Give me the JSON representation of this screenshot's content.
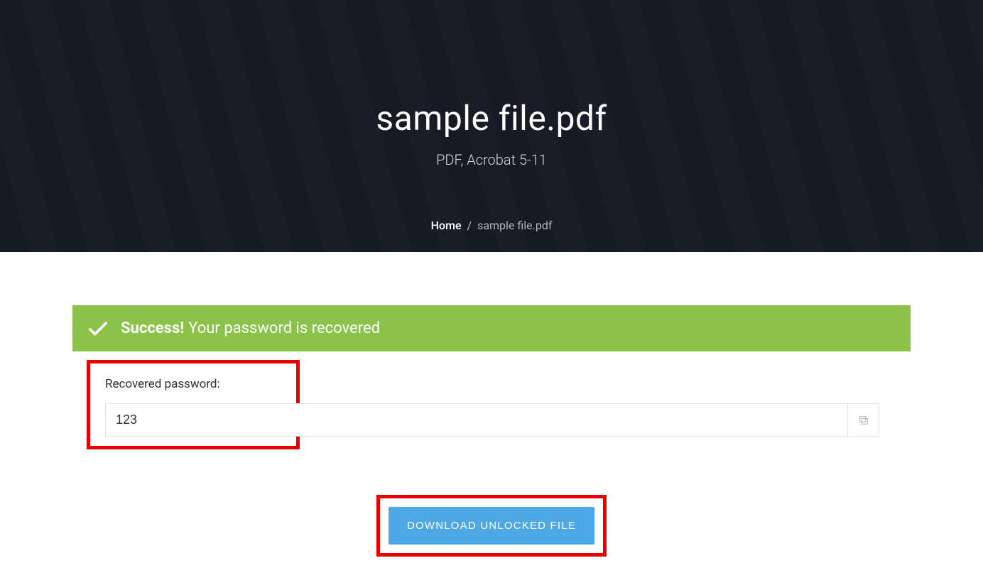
{
  "hero": {
    "title": "sample file.pdf",
    "subtitle": "PDF, Acrobat 5-11"
  },
  "breadcrumb": {
    "home": "Home",
    "current": "sample file.pdf"
  },
  "banner": {
    "strong": "Success!",
    "text": "Your password is recovered"
  },
  "field": {
    "label": "Recovered password:",
    "value": "123"
  },
  "download": {
    "label": "DOWNLOAD UNLOCKED FILE"
  }
}
